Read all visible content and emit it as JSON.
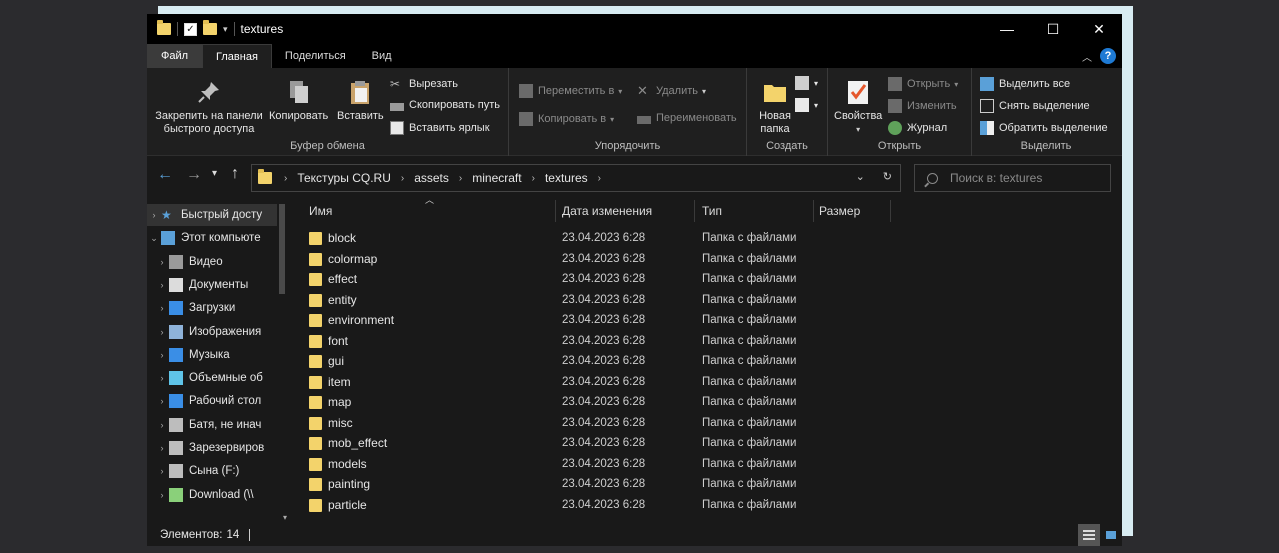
{
  "window": {
    "title": "textures",
    "controls": {
      "minimize": "—",
      "maximize": "☐",
      "close": "✕"
    }
  },
  "tabs": [
    {
      "label": "Файл"
    },
    {
      "label": "Главная"
    },
    {
      "label": "Поделиться"
    },
    {
      "label": "Вид"
    }
  ],
  "help_label": "?",
  "ribbon": {
    "clipboard": {
      "label": "Буфер обмена",
      "pin": "Закрепить на панели быстрого доступа",
      "copy": "Копировать",
      "paste": "Вставить",
      "cut": "Вырезать",
      "copy_path": "Скопировать путь",
      "paste_shortcut": "Вставить ярлык"
    },
    "organize": {
      "label": "Упорядочить",
      "move_to": "Переместить в",
      "copy_to": "Копировать в",
      "delete": "Удалить",
      "rename": "Переименовать"
    },
    "create": {
      "label": "Создать",
      "new_folder": "Новая папка"
    },
    "open": {
      "label": "Открыть",
      "properties": "Свойства",
      "open": "Открыть",
      "edit": "Изменить",
      "history": "Журнал"
    },
    "select": {
      "label": "Выделить",
      "select_all": "Выделить все",
      "select_none": "Снять выделение",
      "invert": "Обратить выделение"
    }
  },
  "address": {
    "crumbs": [
      "Текстуры CQ.RU",
      "assets",
      "minecraft",
      "textures"
    ],
    "search_placeholder": "Поиск в: textures"
  },
  "nav_pane": [
    {
      "label": "Быстрый досту",
      "icon": "star-icon",
      "selected": true
    },
    {
      "label": "Этот компьюте",
      "icon": "computer-icon",
      "expanded": true
    },
    {
      "label": "Видео",
      "icon": "video-icon"
    },
    {
      "label": "Документы",
      "icon": "documents-icon"
    },
    {
      "label": "Загрузки",
      "icon": "download-icon"
    },
    {
      "label": "Изображения",
      "icon": "images-icon"
    },
    {
      "label": "Музыка",
      "icon": "music-icon"
    },
    {
      "label": "Объемные об",
      "icon": "3d-objects-icon"
    },
    {
      "label": "Рабочий стол",
      "icon": "desktop-icon"
    },
    {
      "label": "Батя, не инач",
      "icon": "drive-icon"
    },
    {
      "label": "Зарезервиров",
      "icon": "drive-icon"
    },
    {
      "label": "Сына (F:)",
      "icon": "drive-icon"
    },
    {
      "label": "Download (\\\\",
      "icon": "network-drive-icon"
    }
  ],
  "columns": {
    "name": "Имя",
    "date": "Дата изменения",
    "type": "Тип",
    "size": "Размер"
  },
  "files": [
    {
      "name": "block",
      "date": "23.04.2023 6:28",
      "type": "Папка с файлами"
    },
    {
      "name": "colormap",
      "date": "23.04.2023 6:28",
      "type": "Папка с файлами"
    },
    {
      "name": "effect",
      "date": "23.04.2023 6:28",
      "type": "Папка с файлами"
    },
    {
      "name": "entity",
      "date": "23.04.2023 6:28",
      "type": "Папка с файлами"
    },
    {
      "name": "environment",
      "date": "23.04.2023 6:28",
      "type": "Папка с файлами"
    },
    {
      "name": "font",
      "date": "23.04.2023 6:28",
      "type": "Папка с файлами"
    },
    {
      "name": "gui",
      "date": "23.04.2023 6:28",
      "type": "Папка с файлами"
    },
    {
      "name": "item",
      "date": "23.04.2023 6:28",
      "type": "Папка с файлами"
    },
    {
      "name": "map",
      "date": "23.04.2023 6:28",
      "type": "Папка с файлами"
    },
    {
      "name": "misc",
      "date": "23.04.2023 6:28",
      "type": "Папка с файлами"
    },
    {
      "name": "mob_effect",
      "date": "23.04.2023 6:28",
      "type": "Папка с файлами"
    },
    {
      "name": "models",
      "date": "23.04.2023 6:28",
      "type": "Папка с файлами"
    },
    {
      "name": "painting",
      "date": "23.04.2023 6:28",
      "type": "Папка с файлами"
    },
    {
      "name": "particle",
      "date": "23.04.2023 6:28",
      "type": "Папка с файлами"
    }
  ],
  "status": {
    "label": "Элементов:",
    "count": "14"
  },
  "colors": {
    "folder": "#f3d36b",
    "background": "#191919",
    "accent": "#1e7ad4"
  }
}
